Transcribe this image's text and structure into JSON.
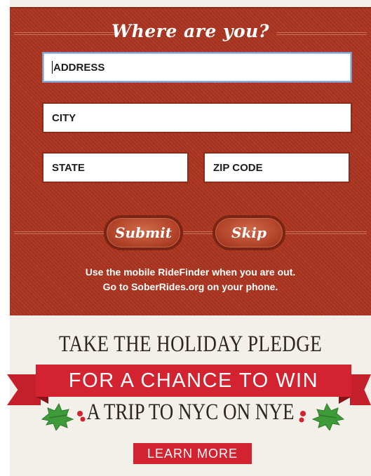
{
  "form": {
    "title": "Where are you?",
    "address_placeholder": "ADDRESS",
    "city_placeholder": "CITY",
    "state_placeholder": "STATE",
    "zip_placeholder": "ZIP CODE",
    "submit_label": "Submit",
    "skip_label": "Skip",
    "info_line1": "Use the mobile RideFinder when you are out.",
    "info_line2": "Go to SoberRides.org on your phone."
  },
  "promo": {
    "heading": "TAKE THE HOLIDAY PLEDGE",
    "banner": "FOR A CHANCE TO WIN",
    "subheading": "A TRIP TO NYC ON NYE",
    "button_label": "LEARN MORE"
  },
  "colors": {
    "panel": "#a9341f",
    "banner_red": "#d32330",
    "holly_green": "#3f9a3a",
    "background": "#f3f0ea"
  },
  "icons": [
    "holly-icon"
  ]
}
